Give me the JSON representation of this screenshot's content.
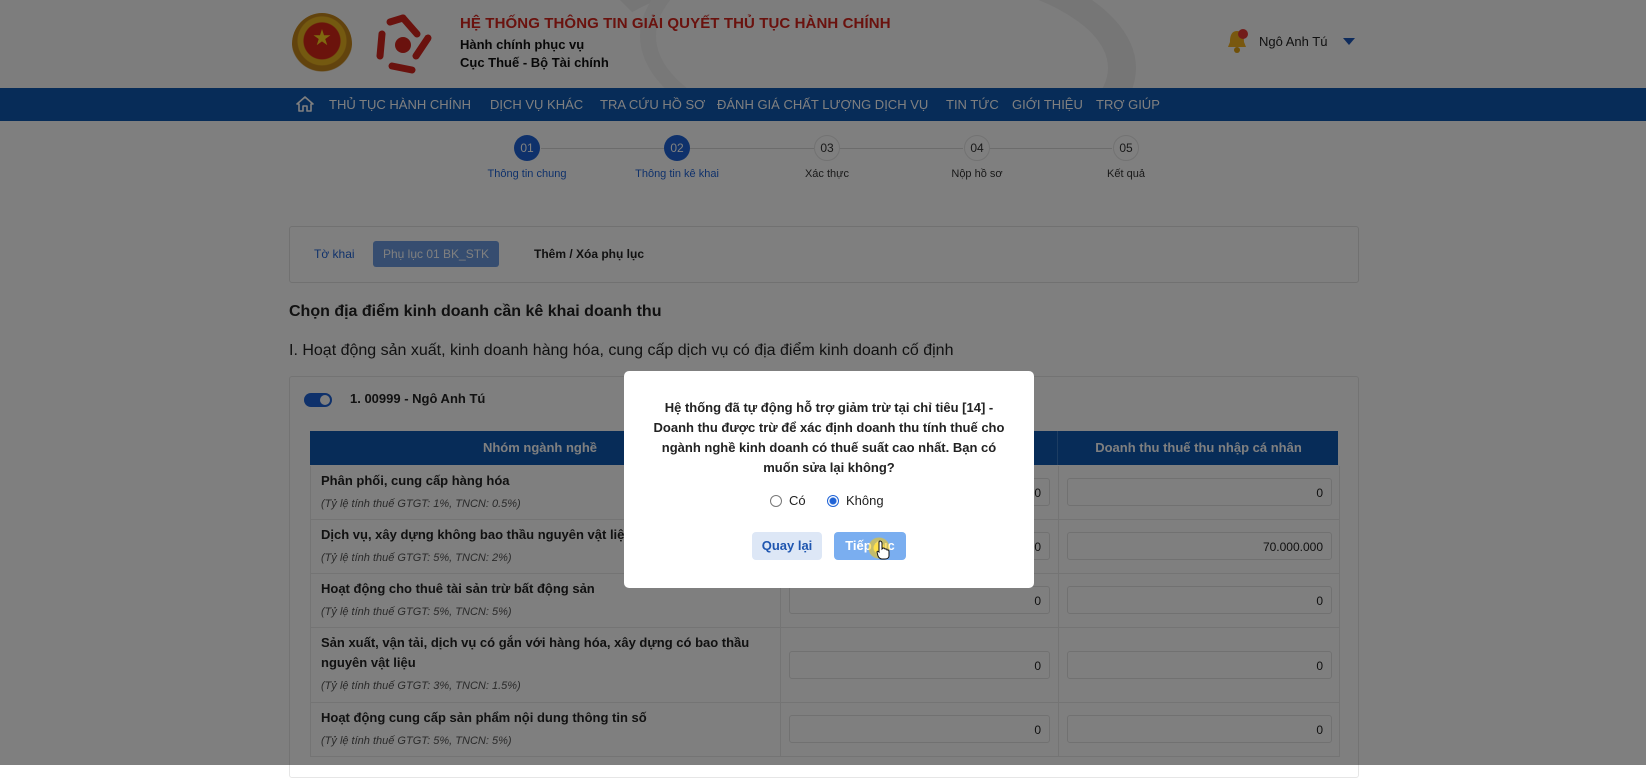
{
  "header": {
    "title": "HỆ THỐNG THÔNG TIN GIẢI QUYẾT THỦ TỤC HÀNH CHÍNH",
    "subtitle_1": "Hành chính phục vụ",
    "subtitle_2": "Cục Thuế - Bộ Tài chính",
    "user_name": "Ngô Anh Tú",
    "icons": [
      "national-emblem",
      "tax-logo",
      "bell-icon",
      "caret-down-icon"
    ]
  },
  "nav": {
    "items": [
      "THỦ TỤC HÀNH CHÍNH",
      "DỊCH VỤ KHÁC",
      "TRA CỨU HỒ SƠ",
      "ĐÁNH GIÁ CHẤT LƯỢNG DỊCH VỤ",
      "TIN TỨC",
      "GIỚI THIỆU",
      "TRỢ GIÚP"
    ]
  },
  "steps": [
    {
      "num": "01",
      "label": "Thông tin chung",
      "active": true
    },
    {
      "num": "02",
      "label": "Thông tin kê khai",
      "active": true
    },
    {
      "num": "03",
      "label": "Xác thực",
      "active": false
    },
    {
      "num": "04",
      "label": "Nộp hồ sơ",
      "active": false
    },
    {
      "num": "05",
      "label": "Kết quả",
      "active": false
    }
  ],
  "tabs": {
    "tab1": "Tờ khai",
    "tab2": "Phụ lục 01 BK_STK",
    "tab3": "Thêm / Xóa phụ lục"
  },
  "section": {
    "title": "Chọn địa điểm kinh doanh cần kê khai doanh thu",
    "subtitle": "I. Hoạt động sản xuất, kinh doanh hàng hóa, cung cấp dịch vụ có địa điểm kinh doanh cố định"
  },
  "location": {
    "label": "1. 00999 - Ngô Anh Tú"
  },
  "table": {
    "headers": {
      "group": "Nhóm ngành nghề",
      "pit_revenue": "Doanh thu thuế thu nhập cá nhân"
    },
    "rows": [
      {
        "name": "Phân phối, cung cấp hàng hóa",
        "note": "(Tỷ lệ tính thuế GTGT: 1%, TNCN: 0.5%)",
        "vat": "0",
        "pit": "0"
      },
      {
        "name": "Dịch vụ, xây dựng không bao thầu nguyên vật liệu",
        "note": "(Tỷ lệ tính thuế GTGT: 5%, TNCN: 2%)",
        "vat": "0",
        "pit": "70.000.000"
      },
      {
        "name": "Hoạt động cho thuê tài sản trừ bất động sản",
        "note": "(Tỷ lệ tính thuế GTGT: 5%, TNCN: 5%)",
        "vat": "0",
        "pit": "0"
      },
      {
        "name": "Sản xuất, vận tải, dịch vụ có gắn với hàng hóa, xây dựng có bao thầu nguyên vật liệu",
        "note": "(Tỷ lệ tính thuế GTGT: 3%, TNCN: 1.5%)",
        "vat": "0",
        "pit": "0"
      },
      {
        "name": "Hoạt động cung cấp sản phẩm nội dung thông tin số",
        "note": "(Tỷ lệ tính thuế GTGT: 5%, TNCN: 5%)",
        "vat": "0",
        "pit": "0"
      }
    ]
  },
  "modal": {
    "message": "Hệ thống đã tự động hỗ trợ giảm trừ tại chỉ tiêu [14] - Doanh thu được trừ để xác định doanh thu tính thuế cho ngành nghề kinh doanh có thuế suất cao nhất. Bạn có muốn sửa lại không?",
    "option_yes": "Có",
    "option_no": "Không",
    "selected": "Không",
    "back_button": "Quay lại",
    "next_button": "Tiếp tục"
  },
  "colors": {
    "nav_bg": "#0f58b1",
    "accent": "#1f63d6",
    "title_red": "#d4241c"
  }
}
